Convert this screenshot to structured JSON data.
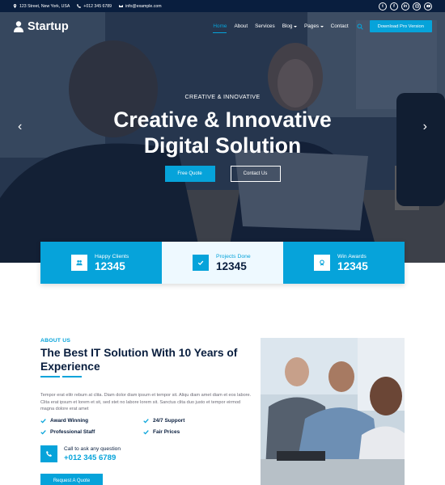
{
  "topbar": {
    "address": "123 Street, New York, USA",
    "phone": "+012 345 6789",
    "email": "info@example.com",
    "socials": [
      "twitter-icon",
      "facebook-icon",
      "linkedin-icon",
      "instagram-icon",
      "youtube-icon"
    ]
  },
  "nav": {
    "brand": "Startup",
    "items": [
      {
        "label": "Home",
        "active": true,
        "dropdown": false
      },
      {
        "label": "About",
        "active": false,
        "dropdown": false
      },
      {
        "label": "Services",
        "active": false,
        "dropdown": false
      },
      {
        "label": "Blog",
        "active": false,
        "dropdown": true
      },
      {
        "label": "Pages",
        "active": false,
        "dropdown": true
      },
      {
        "label": "Contact",
        "active": false,
        "dropdown": false
      }
    ],
    "cta": "Download Pro Version"
  },
  "hero": {
    "subtitle": "CREATIVE & INNOVATIVE",
    "title_line1": "Creative & Innovative",
    "title_line2": "Digital Solution",
    "btn_primary": "Free Quote",
    "btn_secondary": "Contact Us"
  },
  "facts": [
    {
      "label": "Happy Clients",
      "value": "12345",
      "icon": "users-icon"
    },
    {
      "label": "Projects Done",
      "value": "12345",
      "icon": "check-icon"
    },
    {
      "label": "Win Awards",
      "value": "12345",
      "icon": "award-icon"
    }
  ],
  "about": {
    "tag": "ABOUT US",
    "title": "The Best IT Solution With 10 Years of Experience",
    "text": "Tempor erat elitr rebum at clita. Diam dolor diam ipsum et tempor sit. Aliqu diam amet diam et eos labore. Clita erat ipsum et lorem et sit, sed stet no labore lorem sit. Sanctus clita duo justo et tempor eirmod magna dolore erat amet",
    "features": [
      "Award Winning",
      "24/7 Support",
      "Professional Staff",
      "Fair Prices"
    ],
    "call_label": "Call to ask any question",
    "call_number": "+012 345 6789",
    "quote_btn": "Request A Quote"
  },
  "colors": {
    "primary": "#06a3da",
    "dark": "#091e3e",
    "light": "#eef9ff"
  }
}
